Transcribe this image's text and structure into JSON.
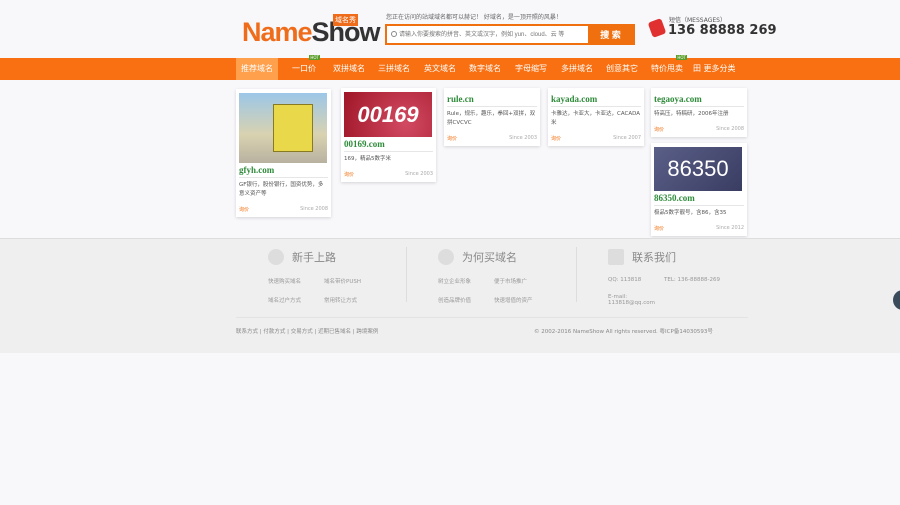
{
  "header": {
    "logo_a": "Name",
    "logo_b": "Show",
    "logo_badge": "域名秀",
    "slogan": "您正在访问的站域域名都可以赫记！ 好域名，是一顶开照的风暴！",
    "search_placeholder": "请输入你要搜索的拼音、英文或汉字，例如 yun、cloud、云 等",
    "search_button": "搜 索",
    "messages_label": "短信（MESSAGES）",
    "phone": "136 88888 269"
  },
  "nav": [
    {
      "label": "推荐域名"
    },
    {
      "label": "一口价",
      "badge": "HOT"
    },
    {
      "label": "双拼域名"
    },
    {
      "label": "三拼域名"
    },
    {
      "label": "英文域名"
    },
    {
      "label": "数字域名"
    },
    {
      "label": "字母缩写"
    },
    {
      "label": "多拼域名"
    },
    {
      "label": "创意其它"
    },
    {
      "label": "特价甩卖",
      "badge": "HOT"
    },
    {
      "label": "田 更多分类"
    }
  ],
  "cards": [
    {
      "image_text": "",
      "domain": "gfyh.com",
      "desc": "GF银行，股份银行，国资优势，多意义资产等",
      "price": "询价",
      "since": "Since 2008"
    },
    {
      "image_text": "00169",
      "domain": "00169.com",
      "desc": "169，精品5数字米",
      "price": "询价",
      "since": "Since 2003"
    },
    {
      "domain": "rule.cn",
      "desc": "Rule，规乐，趣乐，拳回+双拼，双拼CVCVC",
      "price": "询价",
      "since": "Since 2003"
    },
    {
      "domain": "kayada.com",
      "desc": "卡雅达，卡亚大，卡亚达，CACADA米",
      "price": "询价",
      "since": "Since 2007"
    },
    {
      "domain": "tegaoya.com",
      "desc": "特高压，特稿研，2006年注册",
      "price": "询价",
      "since": "Since 2008"
    },
    {
      "image_text": "86350",
      "domain": "86350.com",
      "desc": "极品5数字靓号，含86，含35",
      "price": "询价",
      "since": "Since 2012"
    }
  ],
  "footer": {
    "col1": {
      "title": "新手上路",
      "links": [
        "快速购买域名",
        "域名带价PUSH",
        "域名过户方式",
        "常用转让方式"
      ]
    },
    "col2": {
      "title": "为何买域名",
      "links": [
        "树立企业形象",
        "便于市场推广",
        "创造品牌价值",
        "快速增值的资产"
      ]
    },
    "col3": {
      "title": "联系我们",
      "links": [
        "QQ: 113818",
        "TEL: 136-88888-269",
        "E-mail: 113818@qq.com"
      ]
    },
    "bottom_links": "联系方式 | 付款方式 | 交易方式 | 近期已售域名 | 跨境案例",
    "copyright": "© 2002-2016 NameShow All rights reserved.   粤ICP备14030593号"
  }
}
